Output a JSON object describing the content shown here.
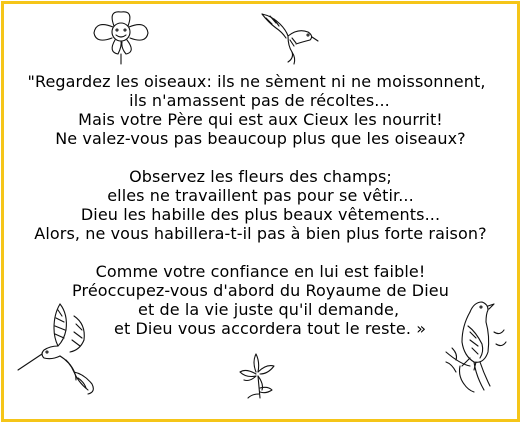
{
  "border_color": "#f5c518",
  "decorations": [
    "flower-icon",
    "hummingbird-icon",
    "hummingbird-icon",
    "flower-sprig-icon",
    "songbird-icon"
  ],
  "stanza1": [
    "\"Regardez les oiseaux: ils ne sèment ni ne moissonnent,",
    "ils n'amassent pas de récoltes...",
    "Mais votre Père qui est aux Cieux les nourrit!",
    "Ne valez-vous pas beaucoup plus que les oiseaux?"
  ],
  "stanza2": [
    "Observez les fleurs des champs;",
    "elles ne travaillent pas pour se vêtir...",
    "Dieu les habille des plus beaux vêtements...",
    "Alors, ne vous habillera-t-il pas à bien plus forte raison?"
  ],
  "stanza3": [
    "Comme votre confiance en lui est faible!",
    "Préoccupez-vous d'abord du Royaume de Dieu",
    "et de la vie juste qu'il demande,",
    "et Dieu vous accordera tout le reste. »"
  ]
}
